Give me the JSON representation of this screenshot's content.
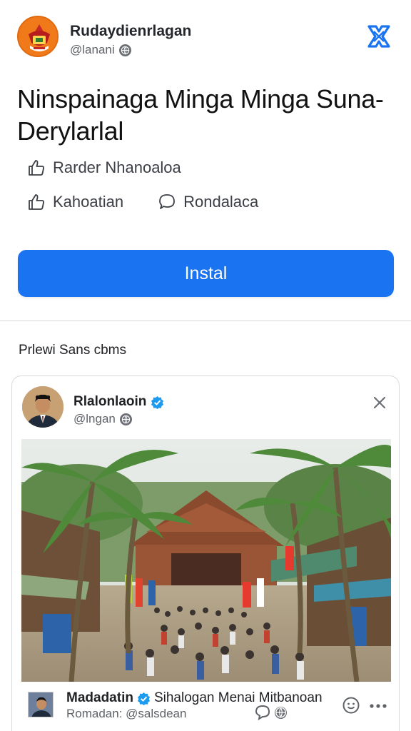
{
  "app": {
    "name": "Rudaydienrlagan",
    "handle": "@lanani",
    "logo_icon": "emblem-logo-icon",
    "brand_icon": "x-brand-icon"
  },
  "headline": "Ninspainaga Minga Minga Suna-Derylarlal",
  "meta": {
    "row1_label": "Rarder Nhanoaloa",
    "row2_like_label": "Kahoatian",
    "row2_comment_label": "Rondalaca"
  },
  "install_button": {
    "label": "Instal",
    "color": "#1a73f0"
  },
  "preview": {
    "section_label": "Prlewi Sans cbms",
    "card": {
      "name": "Rlalonlaoin",
      "handle": "@lngan",
      "footer_title_bold": "Madadatin",
      "footer_title_rest": "Sihalogan Menai Mitbanoan",
      "footer_sub": "Romadan: @salsdean"
    }
  },
  "colors": {
    "accent": "#1a73f0",
    "logo": "#f07a1a",
    "verified": "#1d9bf0"
  }
}
